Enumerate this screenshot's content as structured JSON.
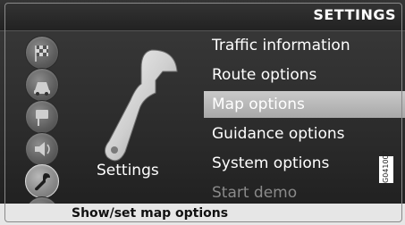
{
  "header": {
    "title": "SETTINGS"
  },
  "sidebar": {
    "icons": [
      {
        "name": "checkered-flag-icon"
      },
      {
        "name": "traffic-icon"
      },
      {
        "name": "map-pin-icon"
      },
      {
        "name": "speaker-icon"
      },
      {
        "name": "wrench-icon",
        "active": true
      },
      {
        "name": "power-icon"
      }
    ]
  },
  "main": {
    "section_label": "Settings",
    "section_icon": "wrench-icon"
  },
  "menu": {
    "items": [
      {
        "label": "Traffic information"
      },
      {
        "label": "Route options"
      },
      {
        "label": "Map options",
        "selected": true
      },
      {
        "label": "Guidance options"
      },
      {
        "label": "System options"
      },
      {
        "label": "Start demo",
        "disabled": true
      }
    ]
  },
  "status": {
    "text": "Show/set map options"
  },
  "figure_code": "G041007",
  "colors": {
    "selected_bg": "#b8b8b8",
    "disabled_text": "#8a8a8a",
    "status_bg": "#e6e6e6"
  }
}
